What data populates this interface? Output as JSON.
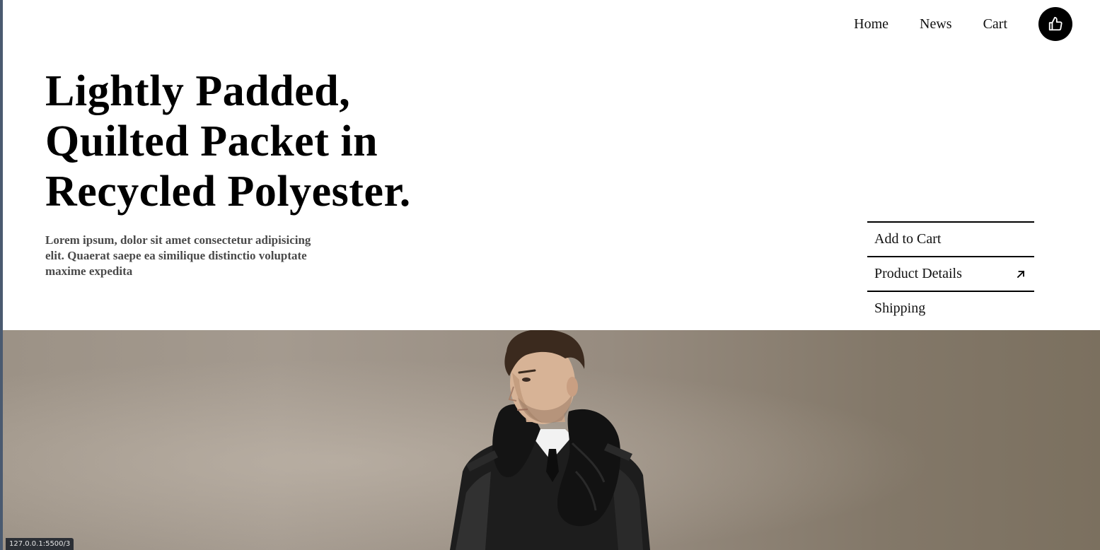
{
  "nav": {
    "items": [
      "Home",
      "News",
      "Cart"
    ],
    "like_icon": "thumbs-up-icon"
  },
  "hero": {
    "title": "Lightly Padded, Quilted Packet in Recycled Polyester.",
    "description": "Lorem ipsum, dolor sit amet consectetur adipisicing elit. Quaerat saepe ea similique distinctio voluptate maxime expedita"
  },
  "side_menu": {
    "items": [
      {
        "label": "Add to Cart"
      },
      {
        "label": "Product Details",
        "icon": "arrow-up-right-icon"
      },
      {
        "label": "Shipping"
      }
    ]
  },
  "hero_image": {
    "subject": "model-in-leather-jacket-and-scarf"
  },
  "status_bar": {
    "url": "127.0.0.1:5500/3"
  },
  "colors": {
    "accent": "#000000",
    "text": "#111111",
    "muted_text": "#4a4a4a",
    "image_bg": "#9a9084"
  }
}
